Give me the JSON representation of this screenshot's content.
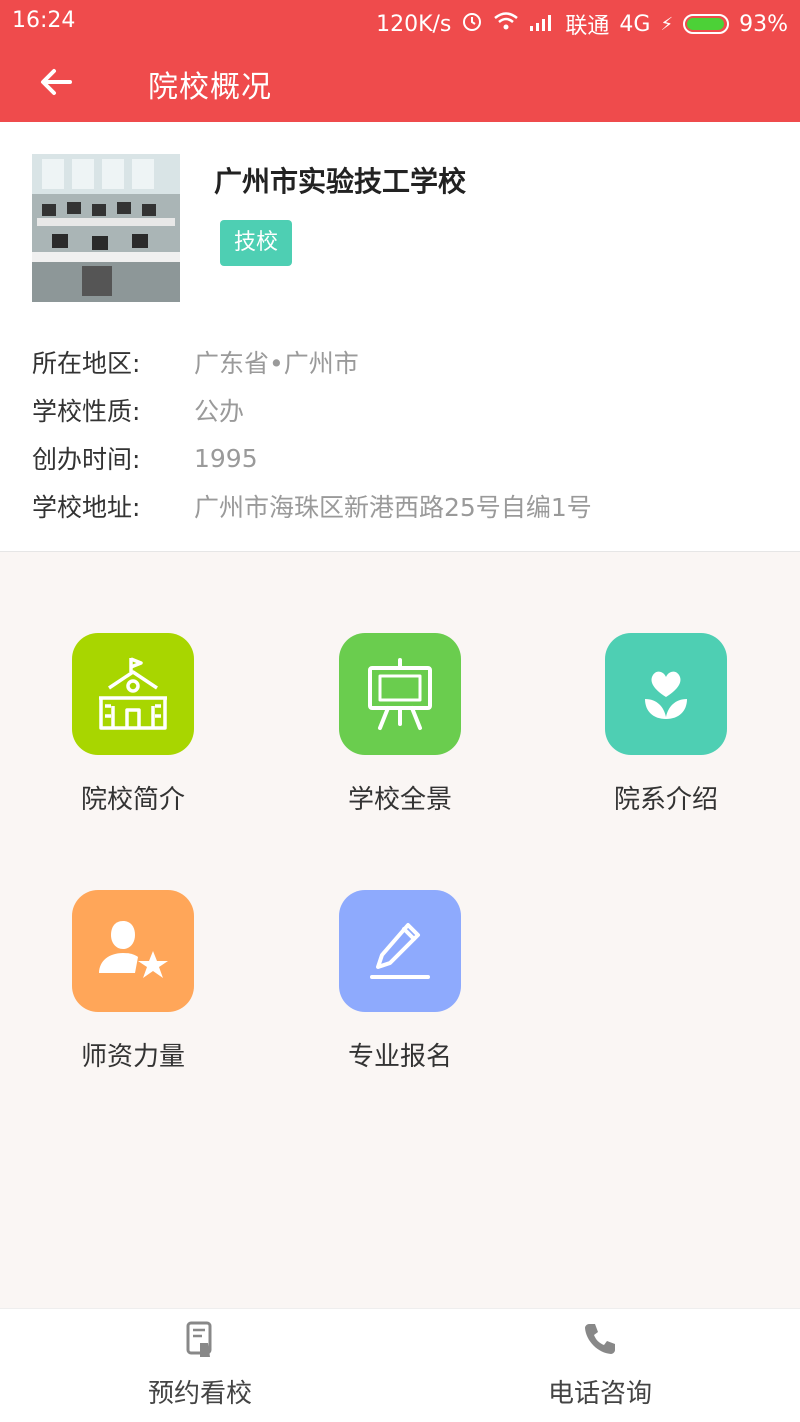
{
  "status_bar": {
    "time": "16:24",
    "speed": "120K/s",
    "carrier": "联通",
    "network": "4G",
    "battery": "93%",
    "battery_level": 0.93,
    "battery_color": "#4cd137"
  },
  "header": {
    "title": "院校概况",
    "background": "#ef4b4c",
    "back_icon": "arrow-left-icon"
  },
  "school": {
    "name": "广州市实验技工学校",
    "tag": "技校",
    "tag_color": "#4ecfb3",
    "details": [
      {
        "label": "所在地区:",
        "value": "广东省•广州市"
      },
      {
        "label": "学校性质:",
        "value": "公办"
      },
      {
        "label": "创办时间:",
        "value": "1995"
      },
      {
        "label": "学校地址:",
        "value": "广州市海珠区新港西路25号自编1号"
      }
    ]
  },
  "menu": [
    {
      "label": "院校简介",
      "icon": "school-building-icon",
      "color": "#a8d600"
    },
    {
      "label": "学校全景",
      "icon": "easel-board-icon",
      "color": "#6acd4e"
    },
    {
      "label": "院系介绍",
      "icon": "flower-icon",
      "color": "#4ecfb3"
    },
    {
      "label": "师资力量",
      "icon": "teacher-star-icon",
      "color": "#ffa659"
    },
    {
      "label": "专业报名",
      "icon": "pencil-edit-icon",
      "color": "#8eaafd"
    }
  ],
  "bottom_bar": {
    "visit": {
      "label": "预约看校",
      "icon": "tablet-hand-icon"
    },
    "call": {
      "label": "电话咨询",
      "icon": "phone-icon"
    }
  }
}
